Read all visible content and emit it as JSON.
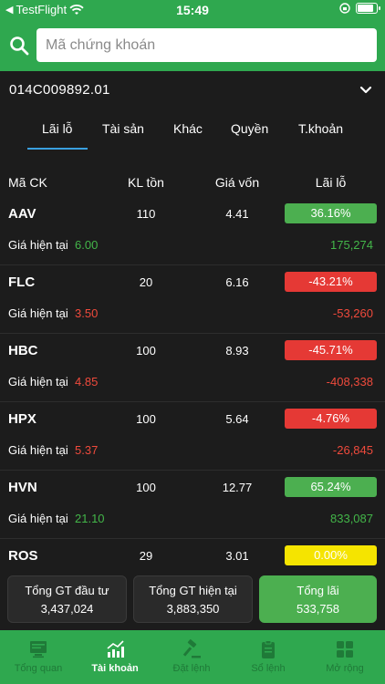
{
  "status": {
    "carrier": "TestFlight",
    "time": "15:49",
    "battery_level": 0.9
  },
  "search": {
    "placeholder": "Mã chứng khoán"
  },
  "account": {
    "id": "014C009892.01"
  },
  "tabs": [
    "Lãi lỗ",
    "Tài sản",
    "Khác",
    "Quyền",
    "T.khoản"
  ],
  "table": {
    "headers": {
      "symbol": "Mã CK",
      "volume": "KL tồn",
      "cost": "Giá vốn",
      "pl": "Lãi lỗ"
    },
    "current_price_label": "Giá hiện tại",
    "rows": [
      {
        "symbol": "AAV",
        "volume": "110",
        "cost": "4.41",
        "pl_pct": "36.16%",
        "current_price": "6.00",
        "pl_value": "175,274",
        "trend": "pos"
      },
      {
        "symbol": "FLC",
        "volume": "20",
        "cost": "6.16",
        "pl_pct": "-43.21%",
        "current_price": "3.50",
        "pl_value": "-53,260",
        "trend": "neg"
      },
      {
        "symbol": "HBC",
        "volume": "100",
        "cost": "8.93",
        "pl_pct": "-45.71%",
        "current_price": "4.85",
        "pl_value": "-408,338",
        "trend": "neg"
      },
      {
        "symbol": "HPX",
        "volume": "100",
        "cost": "5.64",
        "pl_pct": "-4.76%",
        "current_price": "5.37",
        "pl_value": "-26,845",
        "trend": "neg"
      },
      {
        "symbol": "HVN",
        "volume": "100",
        "cost": "12.77",
        "pl_pct": "65.24%",
        "current_price": "21.10",
        "pl_value": "833,087",
        "trend": "pos"
      },
      {
        "symbol": "ROS",
        "volume": "29",
        "cost": "3.01",
        "pl_pct": "0.00%",
        "current_price": "",
        "pl_value": "",
        "trend": "zero"
      }
    ]
  },
  "summary": {
    "invested_label": "Tổng GT đầu tư",
    "invested_value": "3,437,024",
    "current_label": "Tổng GT hiện tại",
    "current_value": "3,883,350",
    "profit_label": "Tổng lãi",
    "profit_value": "533,758"
  },
  "nav": [
    "Tổng quan",
    "Tài khoản",
    "Đặt lệnh",
    "Sổ lệnh",
    "Mở rộng"
  ],
  "colors": {
    "brand_green": "#2fa84f",
    "positive": "#4caf50",
    "negative": "#e53935",
    "neutral": "#f5e400",
    "tab_accent": "#3aa0e0"
  }
}
